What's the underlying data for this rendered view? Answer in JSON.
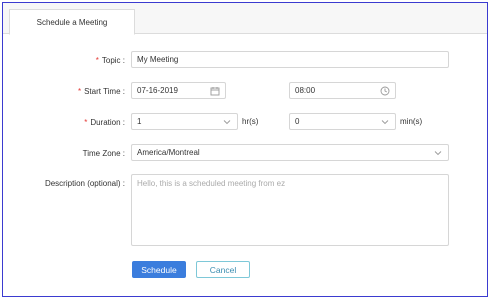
{
  "tab": {
    "label": "Schedule a Meeting"
  },
  "form": {
    "topic": {
      "label": "Topic :",
      "required": true,
      "value": "My Meeting"
    },
    "start_time": {
      "label": "Start Time :",
      "required": true,
      "date": "07-16-2019",
      "time": "08:00"
    },
    "duration": {
      "label": "Duration :",
      "required": true,
      "hours": "1",
      "hours_unit": "hr(s)",
      "minutes": "0",
      "minutes_unit": "min(s)"
    },
    "time_zone": {
      "label": "Time Zone :",
      "value": "America/Montreal"
    },
    "description": {
      "label": "Description (optional) :",
      "placeholder": "Hello, this is a scheduled meeting from ez"
    }
  },
  "buttons": {
    "schedule": "Schedule",
    "cancel": "Cancel"
  },
  "colors": {
    "required_star": "#e53935",
    "primary": "#3b7ddd",
    "frame_border": "#3b3bd0"
  },
  "icons": {
    "date": "calendar-icon",
    "time": "clock-icon",
    "dropdown": "chevron-down-icon"
  }
}
